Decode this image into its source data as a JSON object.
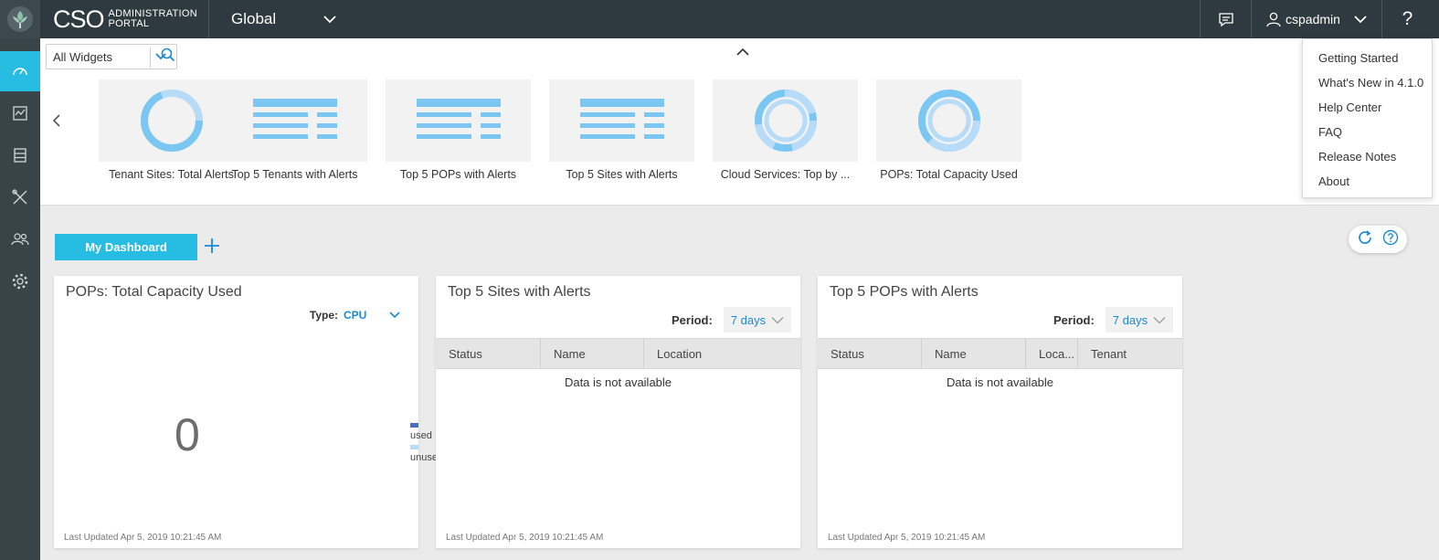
{
  "header": {
    "brand": "CSO",
    "brand_sub_line1": "ADMINISTRATION",
    "brand_sub_line2": "PORTAL",
    "scope": "Global",
    "username": "cspadmin",
    "help_label": "?"
  },
  "nav": {
    "items": [
      "dashboard",
      "monitor",
      "resources",
      "administration",
      "users",
      "settings"
    ],
    "active": "dashboard"
  },
  "tray": {
    "filter_value": "All Widgets",
    "cards": [
      {
        "label": "Tenant Sites: Total Alerts",
        "thumb": "donut"
      },
      {
        "label": "Top 5 Tenants with Alerts",
        "thumb": "list"
      },
      {
        "label": "Top 5 POPs with Alerts",
        "thumb": "list"
      },
      {
        "label": "Top 5 Sites with Alerts",
        "thumb": "list"
      },
      {
        "label": "Cloud Services: Top by ...",
        "thumb": "donut-multi"
      },
      {
        "label": "POPs: Total Capacity Used",
        "thumb": "donut-multi"
      }
    ]
  },
  "help_menu": {
    "items": [
      "Getting Started",
      "What's New in 4.1.0",
      "Help Center",
      "FAQ",
      "Release Notes",
      "About"
    ]
  },
  "dashboard": {
    "tab_label": "My Dashboard",
    "widgets": {
      "capacity": {
        "title": "POPs: Total Capacity Used",
        "type_label": "Type:",
        "type_value": "CPU",
        "value": "0",
        "legend_used": "used",
        "legend_unused": "unused",
        "updated": "Last Updated Apr 5, 2019 10:21:45 AM"
      },
      "sites": {
        "title": "Top 5 Sites with Alerts",
        "period_label": "Period:",
        "period_value": "7 days",
        "columns": [
          "Status",
          "Name",
          "Location"
        ],
        "empty": "Data is not available",
        "updated": "Last Updated Apr 5, 2019 10:21:45 AM"
      },
      "pops": {
        "title": "Top 5 POPs with Alerts",
        "period_label": "Period:",
        "period_value": "7 days",
        "columns": [
          "Status",
          "Name",
          "Loca...",
          "Tenant"
        ],
        "empty": "Data is not available",
        "updated": "Last Updated Apr 5, 2019 10:21:45 AM"
      }
    }
  },
  "colors": {
    "accent": "#27bde3",
    "link": "#1a8ad4",
    "topbar": "#2f3a40",
    "leftnav": "#394449",
    "used": "#4a6fbf",
    "unused": "#b8dcf7"
  }
}
